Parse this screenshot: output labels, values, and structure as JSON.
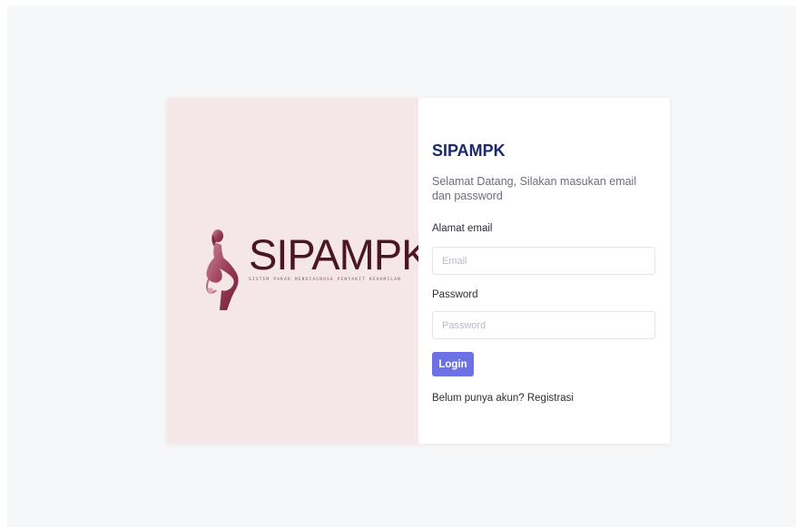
{
  "logo": {
    "title": "SIPAMPK",
    "subtitle": "SISTEM PAKAR MENDIAGNOSA PENYAKIT KEHAMILAN",
    "figure_icon": "pregnant-woman-silhouette-icon",
    "brand_color": "#8b2f4e"
  },
  "form": {
    "title": "SIPAMPK",
    "welcome": "Selamat Datang, Silakan masukan email dan password",
    "email_label": "Alamat email",
    "email_placeholder": "Email",
    "email_value": "",
    "password_label": "Password",
    "password_placeholder": "Password",
    "password_value": "",
    "login_label": "Login",
    "register_prompt": "Belum punya akun?",
    "register_link": "Registrasi"
  },
  "colors": {
    "accent": "#6c72e6",
    "title": "#1a2a6c",
    "brand_panel_bg": "#f5e6e8",
    "page_bg": "#f6f7f9"
  }
}
